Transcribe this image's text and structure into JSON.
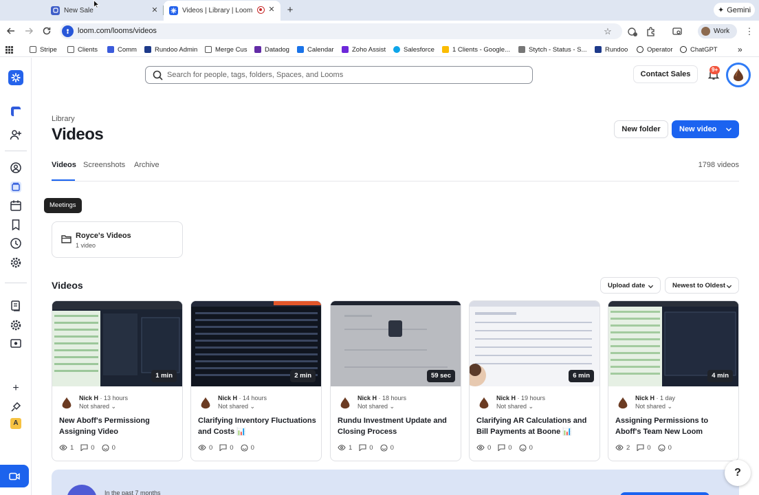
{
  "browser": {
    "tabs": [
      {
        "title": "New Sale"
      },
      {
        "title": "Videos | Library | Loom"
      }
    ],
    "gemini_label": "Gemini",
    "url": "loom.com/looms/videos",
    "profile_label": "Work",
    "bookmarks": [
      {
        "label": "Stripe",
        "icon": "folder-icon"
      },
      {
        "label": "Clients",
        "icon": "folder-icon"
      },
      {
        "label": "Comm",
        "icon": "app-icon"
      },
      {
        "label": "Rundoo Admin",
        "icon": "app-icon"
      },
      {
        "label": "Merge Cus",
        "icon": "folder-icon"
      },
      {
        "label": "Datadog",
        "icon": "app-icon"
      },
      {
        "label": "Calendar",
        "icon": "calendar-icon"
      },
      {
        "label": "Zoho Assist",
        "icon": "app-icon"
      },
      {
        "label": "Salesforce",
        "icon": "cloud-icon"
      },
      {
        "label": "1 Clients - Google...",
        "icon": "drive-icon"
      },
      {
        "label": "Stytch - Status - S...",
        "icon": "app-icon"
      },
      {
        "label": "Rundoo",
        "icon": "app-icon"
      },
      {
        "label": "Operator",
        "icon": "app-icon"
      },
      {
        "label": "ChatGPT",
        "icon": "app-icon"
      }
    ]
  },
  "app": {
    "search_placeholder": "Search for people, tags, folders, Spaces, and Looms",
    "contact_sales": "Contact Sales",
    "notification_badge": "9+",
    "tooltip": "Meetings",
    "workspace_initial": "A",
    "breadcrumb": "Library",
    "page_title": "Videos",
    "new_folder": "New folder",
    "new_video": "New video",
    "tabs": [
      {
        "label": "Videos"
      },
      {
        "label": "Screenshots"
      },
      {
        "label": "Archive"
      }
    ],
    "video_count": "1798 videos",
    "folder": {
      "name": "Royce's Videos",
      "sub": "1 video"
    },
    "section_title": "Videos",
    "sort_field": "Upload date",
    "sort_order": "Newest to Oldest",
    "banner_text": "In the past 7 months",
    "help": "?"
  },
  "videos": [
    {
      "owner": "Nick H",
      "age": "13 hours",
      "share": "Not shared",
      "duration": "1 min",
      "title": "New Aboff's Permissiong Assigning Video",
      "views": "1",
      "comments": "0",
      "reactions": "0"
    },
    {
      "owner": "Nick H",
      "age": "14 hours",
      "share": "Not shared",
      "duration": "2 min",
      "title": "Clarifying Inventory Fluctuations and Costs 📊",
      "views": "0",
      "comments": "0",
      "reactions": "0"
    },
    {
      "owner": "Nick H",
      "age": "18 hours",
      "share": "Not shared",
      "duration": "59 sec",
      "title": "Rundu Investment Update and Closing Process",
      "views": "1",
      "comments": "0",
      "reactions": "0"
    },
    {
      "owner": "Nick H",
      "age": "19 hours",
      "share": "Not shared",
      "duration": "6 min",
      "title": "Clarifying AR Calculations and Bill Payments at Boone 📊",
      "views": "0",
      "comments": "0",
      "reactions": "0"
    },
    {
      "owner": "Nick H",
      "age": "1 day",
      "share": "Not shared",
      "duration": "4 min",
      "title": "Assigning Permissions to Aboff's Team New Loom",
      "views": "2",
      "comments": "0",
      "reactions": "0"
    }
  ],
  "colors": {
    "accent": "#1b63f0",
    "tab_bar": "#dfe6f2"
  }
}
